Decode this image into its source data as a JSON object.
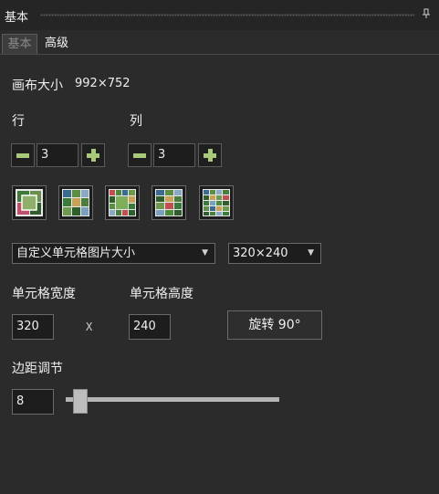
{
  "panel": {
    "title": "基本",
    "pin_icon": "pin-icon"
  },
  "tabs": [
    {
      "label": "基本",
      "active": true
    },
    {
      "label": "高级",
      "active": false
    }
  ],
  "canvas": {
    "label": "画布大小",
    "value": "992×752"
  },
  "rows": {
    "label": "行",
    "value": "3"
  },
  "cols": {
    "label": "列",
    "value": "3"
  },
  "layouts": [
    {
      "name": "layout-3-photos"
    },
    {
      "name": "layout-6-photos"
    },
    {
      "name": "layout-9-photos"
    },
    {
      "name": "layout-12-photos"
    },
    {
      "name": "layout-15-photos"
    }
  ],
  "cell_size_mode": {
    "selected": "自定义单元格图片大小"
  },
  "cell_size_preset": {
    "selected": "320×240"
  },
  "cell_width": {
    "label": "单元格宽度",
    "value": "320"
  },
  "cell_height": {
    "label": "单元格高度",
    "value": "240"
  },
  "times_symbol": "X",
  "rotate_button": {
    "label": "旋转 90°"
  },
  "margin": {
    "label": "边距调节",
    "value": "8"
  },
  "colors": {
    "accent_green": "#a8c97a",
    "background": "#2b2b2b"
  }
}
